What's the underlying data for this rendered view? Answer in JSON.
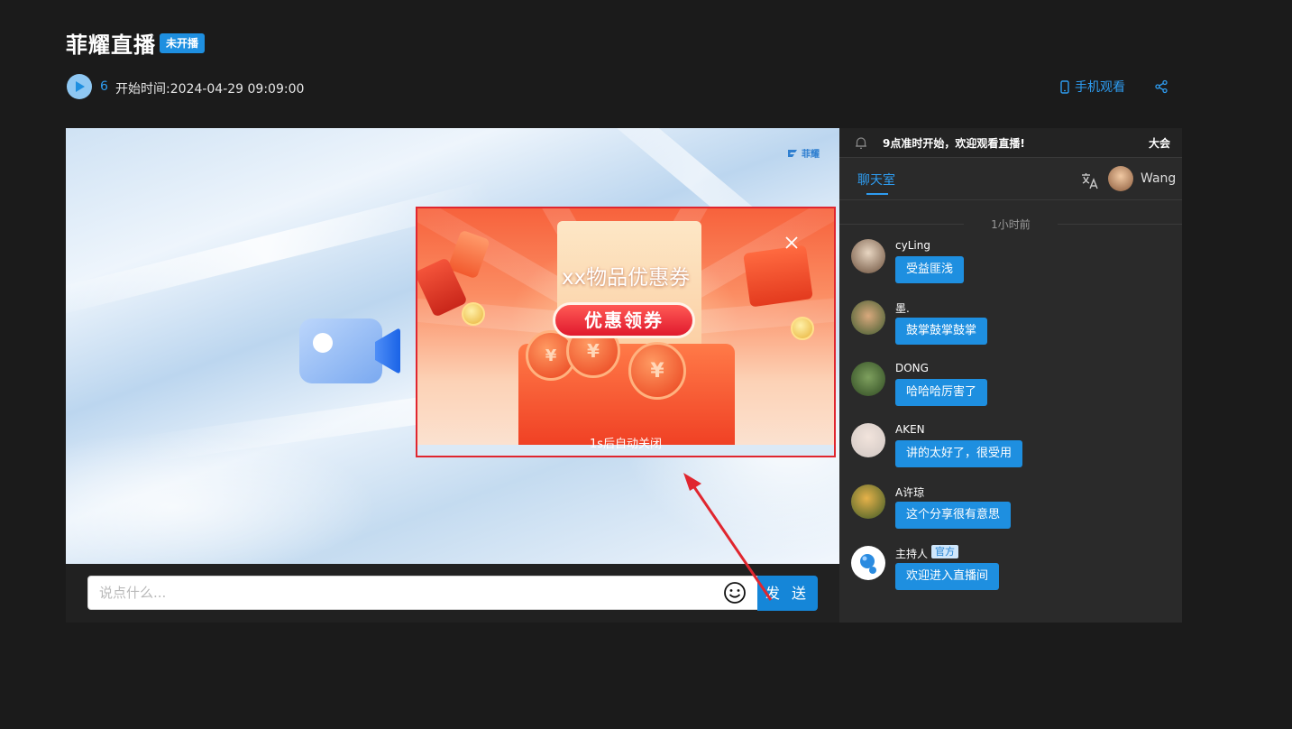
{
  "header": {
    "title": "菲耀直播",
    "status_badge": "未开播",
    "viewer_count": "6",
    "start_time": "开始时间:2024-04-29 09:09:00",
    "mobile_watch": "手机观看"
  },
  "player": {
    "brand_logo": "菲耀",
    "popup": {
      "title": "xx物品优惠券",
      "claim_button": "优惠领券",
      "auto_close_text": "1s后自动关闭"
    }
  },
  "input_bar": {
    "placeholder": "说点什么...",
    "send_label": "发 送"
  },
  "sidebar": {
    "notice": "9点准时开始，欢迎观看直播!",
    "notice_overflow": "大会",
    "tab_chat": "聊天室",
    "user_name": "Wang",
    "time_divider": "1小时前",
    "messages": [
      {
        "user": "cyLing",
        "text": "受益匪浅"
      },
      {
        "user": "墨.",
        "text": "鼓掌鼓掌鼓掌"
      },
      {
        "user": "DONG",
        "text": "哈哈哈厉害了"
      },
      {
        "user": "AKEN",
        "text": "讲的太好了，很受用"
      },
      {
        "user": "A许琼",
        "text": "这个分享很有意思"
      },
      {
        "user": "主持人",
        "text": "欢迎进入直播间",
        "tag": "官方"
      }
    ]
  },
  "colors": {
    "accent": "#1e8fe0",
    "link": "#2e9cf0",
    "page_bg": "#1b1b1b",
    "sidebar_bg": "#2a2a2a",
    "highlight_border": "#e0262f"
  }
}
